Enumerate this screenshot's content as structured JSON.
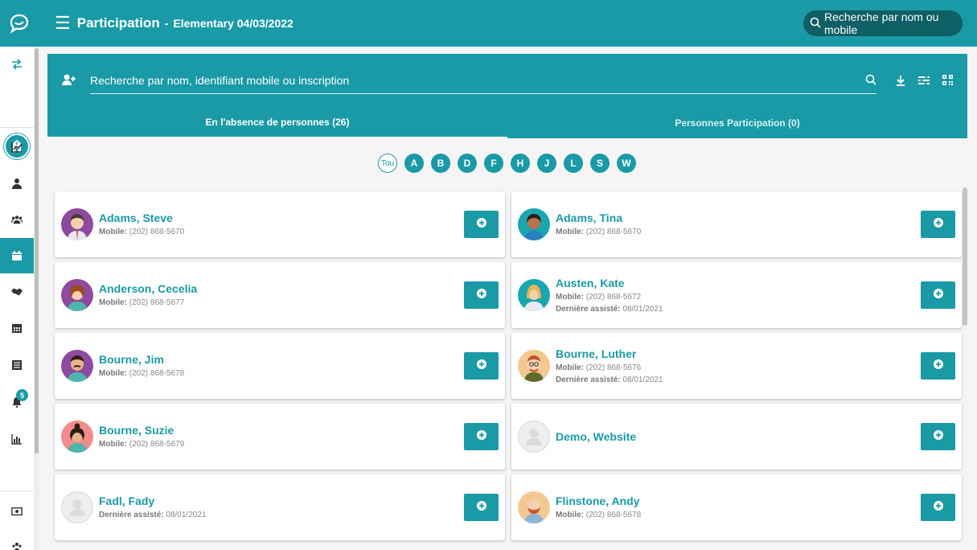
{
  "header": {
    "title": "Participation",
    "separator": "-",
    "subtitle": "Elementary 04/03/2022",
    "search_placeholder": "Recherche par nom ou mobile"
  },
  "sidebar": {
    "items": [
      "swap-icon",
      "trend-icon",
      "person-icon",
      "group-icon",
      "calendar-icon",
      "handshake-icon",
      "calendar-grid-icon",
      "list-icon",
      "bell-icon",
      "bar-chart-icon",
      "money-icon",
      "users-icon"
    ],
    "active": "calendar-icon",
    "notification_count": "5"
  },
  "panel": {
    "search_placeholder": "Recherche par nom, identifiant mobile ou inscription",
    "tabs": [
      {
        "label": "En l'absence de personnes (26)",
        "active": true
      },
      {
        "label": "Personnes Participation (0)",
        "active": false
      }
    ]
  },
  "letters": [
    "Tou",
    "A",
    "B",
    "D",
    "F",
    "H",
    "J",
    "L",
    "S",
    "W"
  ],
  "mobile_label": "Mobile:",
  "last_label": "Dernière assisté:",
  "people": [
    {
      "name": "Adams, Steve",
      "mobile": "(202) 868-5670",
      "last": "",
      "avatar": "man-purple"
    },
    {
      "name": "Adams, Tina",
      "mobile": "(202) 868-5670",
      "last": "",
      "avatar": "woman-teal"
    },
    {
      "name": "Anderson, Cecelia",
      "mobile": "(202) 868-5677",
      "last": "",
      "avatar": "woman-purple"
    },
    {
      "name": "Austen, Kate",
      "mobile": "(202) 868-5672",
      "last": "08/01/2021",
      "avatar": "woman-blonde"
    },
    {
      "name": "Bourne, Jim",
      "mobile": "(202) 868-5678",
      "last": "",
      "avatar": "man-mustache"
    },
    {
      "name": "Bourne, Luther",
      "mobile": "(202) 868-5676",
      "last": "08/01/2021",
      "avatar": "man-glasses"
    },
    {
      "name": "Bourne, Suzie",
      "mobile": "(202) 868-5679",
      "last": "",
      "avatar": "woman-pink"
    },
    {
      "name": "Demo, Website",
      "mobile": "",
      "last": "",
      "avatar": "placeholder"
    },
    {
      "name": "Fadl, Fady",
      "mobile": "",
      "last": "08/01/2021",
      "avatar": "placeholder"
    },
    {
      "name": "Flinstone, Andy",
      "mobile": "(202) 868-5678",
      "last": "",
      "avatar": "man-beard"
    }
  ],
  "colors": {
    "primary": "#1a9aa6",
    "dark_search": "#0f5f66"
  }
}
